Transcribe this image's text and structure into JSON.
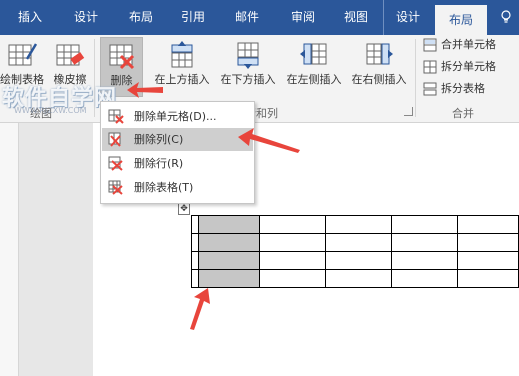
{
  "tabs": [
    {
      "label": "插入",
      "active": false
    },
    {
      "label": "设计",
      "active": false
    },
    {
      "label": "布局",
      "active": false
    },
    {
      "label": "引用",
      "active": false
    },
    {
      "label": "邮件",
      "active": false
    },
    {
      "label": "审阅",
      "active": false
    },
    {
      "label": "视图",
      "active": false
    },
    {
      "label": "设计",
      "active": false
    },
    {
      "label": "布局",
      "active": true
    }
  ],
  "ribbon": {
    "draw_table": "绘制表格",
    "eraser": "橡皮擦",
    "delete": "删除",
    "insert_above": "在上方插入",
    "insert_below": "在下方插入",
    "insert_left": "在左侧插入",
    "insert_right": "在右侧插入",
    "merge_cells": "合并单元格",
    "split_cells": "拆分单元格",
    "split_table": "拆分表格",
    "group_draw": "绘图",
    "group_rows_cols": "行和列",
    "group_merge": "合并"
  },
  "delete_menu": {
    "items": [
      {
        "label": "删除单元格(D)...",
        "highlighted": false
      },
      {
        "label": "删除列(C)",
        "highlighted": true
      },
      {
        "label": "删除行(R)",
        "highlighted": false
      },
      {
        "label": "删除表格(T)",
        "highlighted": false
      }
    ]
  },
  "watermark": {
    "text": "软件自学网",
    "url": "WWW.RJZXW.COM"
  },
  "colors": {
    "accent": "#2b579a",
    "arrow": "#e8453c",
    "selection": "#c6c6c6"
  },
  "table": {
    "rows": 4,
    "columns": 6,
    "selected_column": 1
  }
}
